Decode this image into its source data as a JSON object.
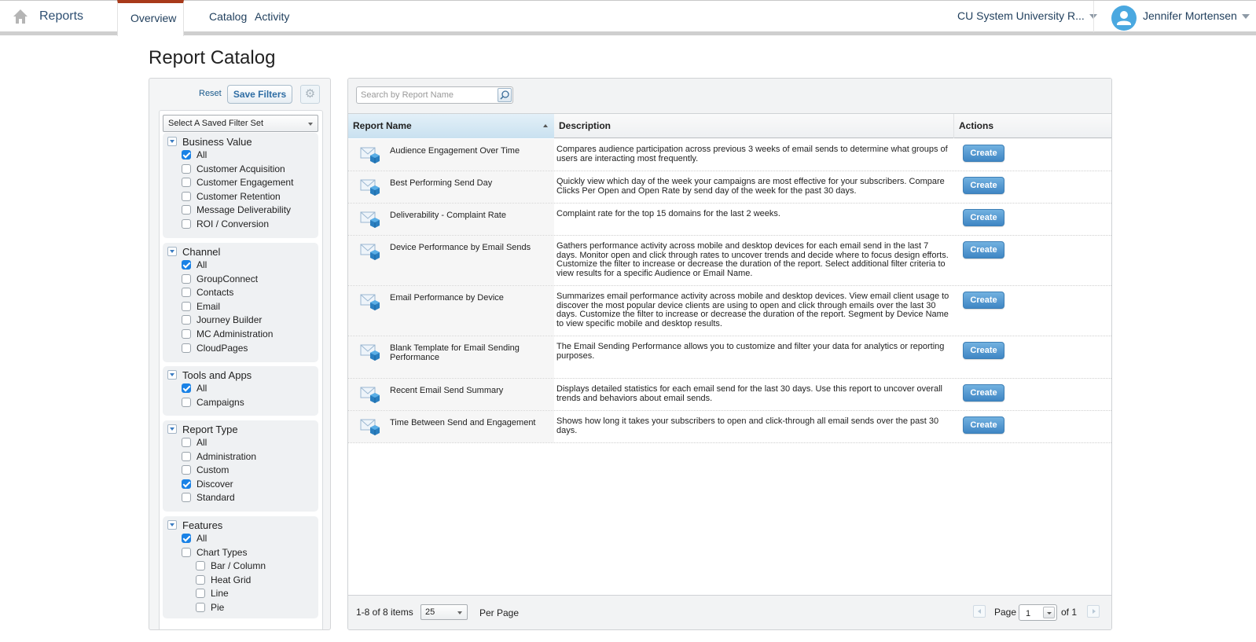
{
  "topnav": {
    "app_title": "Reports",
    "tabs": [
      {
        "label": "Overview",
        "active": true
      },
      {
        "label": "Catalog",
        "active": false
      },
      {
        "label": "Activity",
        "active": false
      }
    ],
    "org_selector": "CU System University R...",
    "user_name": "Jennifer Mortensen",
    "accent_color": "#a83a1a"
  },
  "page": {
    "title": "Report Catalog"
  },
  "filters": {
    "reset_label": "Reset",
    "save_label": "Save Filters",
    "saved_filter_select": "Select A Saved Filter Set",
    "groups": [
      {
        "title": "Business Value",
        "options": [
          {
            "label": "All",
            "checked": true
          },
          {
            "label": "Customer Acquisition",
            "checked": false
          },
          {
            "label": "Customer Engagement",
            "checked": false
          },
          {
            "label": "Customer Retention",
            "checked": false
          },
          {
            "label": "Message Deliverability",
            "checked": false
          },
          {
            "label": "ROI / Conversion",
            "checked": false
          }
        ]
      },
      {
        "title": "Channel",
        "options": [
          {
            "label": "All",
            "checked": true
          },
          {
            "label": "GroupConnect",
            "checked": false
          },
          {
            "label": "Contacts",
            "checked": false
          },
          {
            "label": "Email",
            "checked": false
          },
          {
            "label": "Journey Builder",
            "checked": false
          },
          {
            "label": "MC Administration",
            "checked": false
          },
          {
            "label": "CloudPages",
            "checked": false
          }
        ]
      },
      {
        "title": "Tools and Apps",
        "options": [
          {
            "label": "All",
            "checked": true
          },
          {
            "label": "Campaigns",
            "checked": false
          }
        ]
      },
      {
        "title": "Report Type",
        "options": [
          {
            "label": "All",
            "checked": false
          },
          {
            "label": "Administration",
            "checked": false
          },
          {
            "label": "Custom",
            "checked": false
          },
          {
            "label": "Discover",
            "checked": true
          },
          {
            "label": "Standard",
            "checked": false
          }
        ]
      },
      {
        "title": "Features",
        "options": [
          {
            "label": "All",
            "checked": true,
            "indent": 0
          },
          {
            "label": "Chart Types",
            "checked": false,
            "indent": 0
          },
          {
            "label": "Bar / Column",
            "checked": false,
            "indent": 1
          },
          {
            "label": "Heat Grid",
            "checked": false,
            "indent": 1
          },
          {
            "label": "Line",
            "checked": false,
            "indent": 1
          },
          {
            "label": "Pie",
            "checked": false,
            "indent": 1
          }
        ]
      }
    ]
  },
  "grid": {
    "search_placeholder": "Search by Report Name",
    "columns": {
      "name": "Report Name",
      "description": "Description",
      "actions": "Actions"
    },
    "sort": "ascending",
    "create_label": "Create",
    "rows": [
      {
        "name": "Audience Engagement Over Time",
        "description": "Compares audience participation across previous 3 weeks of email sends to determine what groups of users are interacting most frequently."
      },
      {
        "name": "Best Performing Send Day",
        "description": "Quickly view which day of the week your campaigns are most effective for your subscribers. Compare Clicks Per Open and Open Rate by send day of the week for the past 30 days."
      },
      {
        "name": "Deliverability - Complaint Rate",
        "description": "Complaint rate for the top 15 domains for the last 2 weeks."
      },
      {
        "name": "Device Performance by Email Sends",
        "description": "Gathers performance activity across mobile and desktop devices for each email send in the last 7 days. Monitor open and click through rates to uncover trends and decide where to focus design efforts. Customize the filter to increase or decrease the duration of the report. Select additional filter criteria to view results for a specific Audience or Email Name."
      },
      {
        "name": "Email Performance by Device",
        "description": "Summarizes email performance activity across mobile and desktop devices. View email client usage to discover the most popular device clients are using to open and click through emails over the last 30 days. Customize the filter to increase or decrease the duration of the report. Segment by Device Name to view specific mobile and desktop results."
      },
      {
        "name": "Blank Template for Email Sending Performance",
        "description": "The Email Sending Performance allows you to customize and filter your data for analytics or reporting purposes."
      },
      {
        "name": "Recent Email Send Summary",
        "description": "Displays detailed statistics for each email send for the last 30 days. Use this report to uncover overall trends and behaviors about email sends."
      },
      {
        "name": "Time Between Send and Engagement",
        "description": "Shows how long it takes your subscribers to open and click-through all email sends over the past 30 days."
      }
    ],
    "footer": {
      "items_count": "1-8 of 8 items",
      "per_page_value": "25",
      "per_page_label": "Per Page",
      "page_label": "Page",
      "current_page": "1",
      "of_label": "of 1"
    }
  }
}
